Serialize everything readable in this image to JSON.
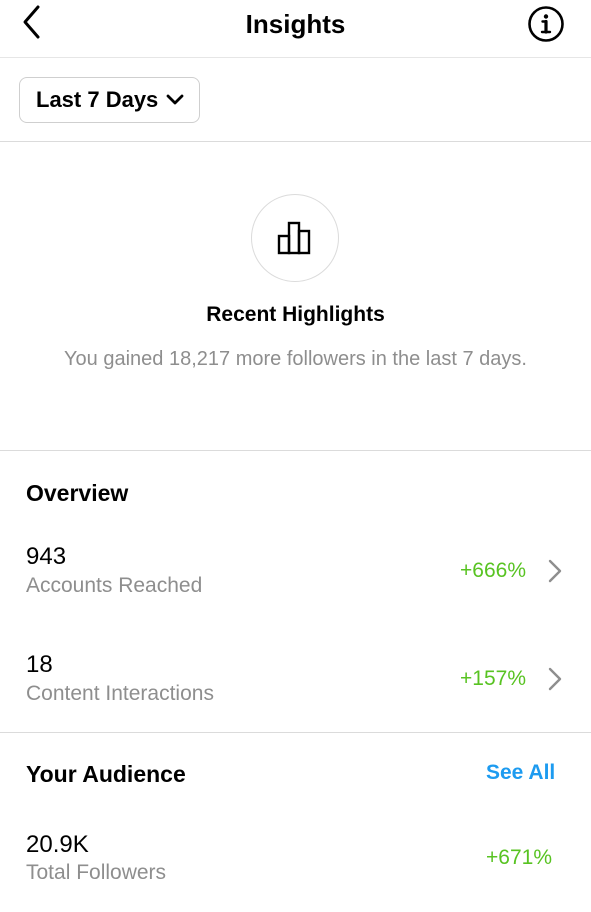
{
  "header": {
    "title": "Insights"
  },
  "filter": {
    "range_label": "Last 7 Days"
  },
  "highlights": {
    "title": "Recent Highlights",
    "description": "You gained 18,217 more followers in the last 7 days."
  },
  "overview": {
    "title": "Overview",
    "metrics": [
      {
        "value": "943",
        "label": "Accounts Reached",
        "change": "+666%"
      },
      {
        "value": "18",
        "label": "Content Interactions",
        "change": "+157%"
      }
    ]
  },
  "audience": {
    "title": "Your Audience",
    "see_all": "See All",
    "metric": {
      "value": "20.9K",
      "label": "Total Followers",
      "change": "+671%"
    }
  },
  "colors": {
    "positive": "#58c322",
    "link": "#1d9bf0",
    "muted_text": "#8e8e8e",
    "divider": "#dbdbdb"
  },
  "icons": [
    "chevron-left-icon",
    "info-icon",
    "chevron-down-icon",
    "bar-chart-icon",
    "chevron-right-icon"
  ]
}
